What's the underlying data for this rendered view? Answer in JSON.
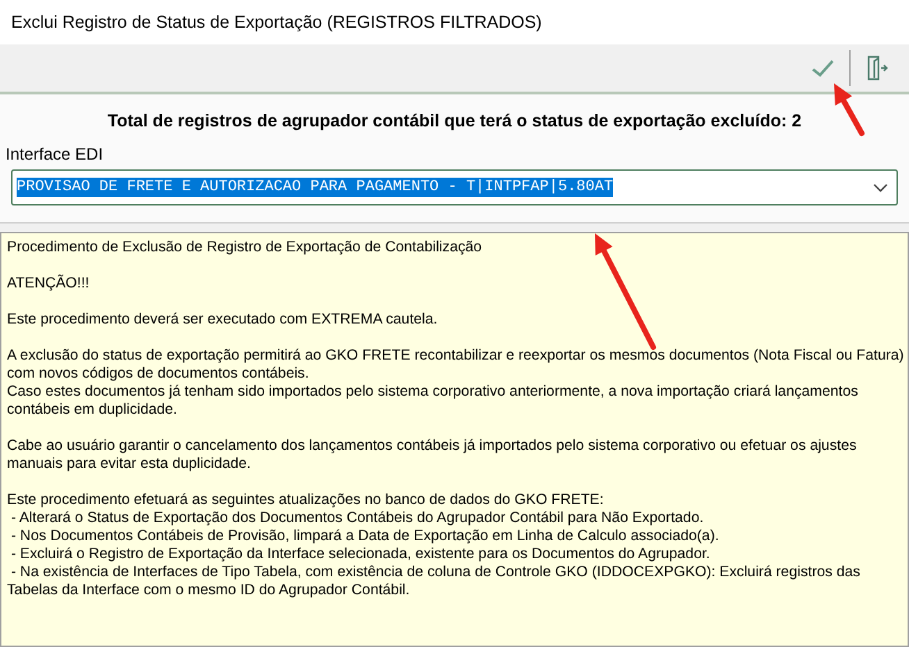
{
  "window": {
    "title": "Exclui Registro de Status de Exportação (REGISTROS FILTRADOS)"
  },
  "toolbar": {
    "buttons": [
      {
        "kind": "confirm"
      },
      {
        "kind": "exit"
      }
    ]
  },
  "summary": "Total de registros de agrupador contábil que terá o status de exportação excluído: 2",
  "interface_edi": {
    "label": "Interface EDI",
    "value": "PROVISAO DE FRETE E AUTORIZACAO PARA PAGAMENTO - T|INTPFAP|5.80AT",
    "selected": true
  },
  "memo": {
    "paragraphs": [
      [
        "Procedimento de Exclusão de Registro de Exportação de Contabilização"
      ],
      [
        "ATENÇÃO!!!"
      ],
      [
        "Este procedimento deverá ser executado com EXTREMA cautela."
      ],
      [
        "A exclusão do status de exportação permitirá ao GKO FRETE recontabilizar e reexportar os mesmos documentos (Nota Fiscal ou Fatura)",
        "com novos códigos de documentos contábeis.",
        "Caso estes documentos já tenham sido importados pelo sistema corporativo anteriormente, a nova importação criará lançamentos",
        "contábeis em duplicidade."
      ],
      [
        "Cabe ao usuário garantir o cancelamento dos lançamentos contábeis já importados pelo sistema corporativo ou efetuar os ajustes",
        "manuais para evitar esta duplicidade."
      ],
      [
        "Este procedimento efetuará as seguintes atualizações no banco de dados do GKO FRETE:",
        " - Alterará o Status de Exportação dos Documentos Contábeis do Agrupador Contábil para Não Exportado.",
        " - Nos Documentos Contábeis de Provisão, limpará a Data de Exportação em Linha de Calculo associado(a).",
        " - Excluirá o Registro de Exportação da Interface selecionada, existente para os Documentos do Agrupador.",
        " - Na existência de Interfaces de Tipo Tabela, com existência de coluna de Controle GKO (IDDOCEXPGKO): Excluirá registros das",
        "Tabelas da Interface com o mesmo ID do Agrupador Contábil."
      ]
    ]
  }
}
